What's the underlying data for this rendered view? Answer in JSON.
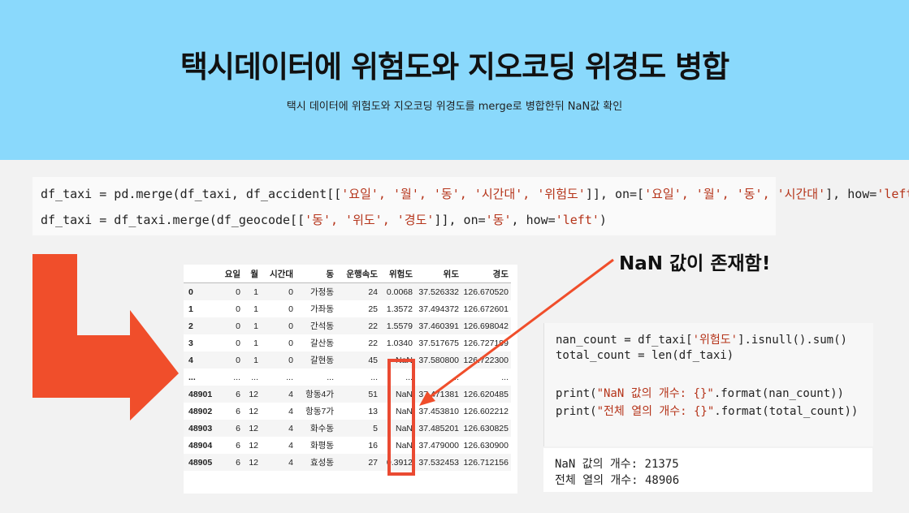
{
  "header": {
    "title": "택시데이터에 위험도와 지오코딩 위경도 병합",
    "subtitle": "택시 데이터에 위험도와 지오코딩 위경도를 merge로 병합한뒤 NaN값 확인"
  },
  "code_cell_1": {
    "line1_a": "df_taxi = pd.merge(df_taxi, df_accident[[",
    "line1_s1": "'요일', '월', '동', '시간대', '위험도'",
    "line1_b": "]], on=[",
    "line1_s2": "'요일', '월', '동', '시간대'",
    "line1_c": "], how=",
    "line1_s3": "'left'",
    "line1_d": ")",
    "line2_a": "df_taxi = df_taxi.merge(df_geocode[[",
    "line2_s1": "'동', '위도', '경도'",
    "line2_b": "]], on=",
    "line2_s2": "'동'",
    "line2_c": ", how=",
    "line2_s3": "'left'",
    "line2_d": ")"
  },
  "dataframe": {
    "columns": [
      "",
      "요일",
      "월",
      "시간대",
      "동",
      "운행속도",
      "위험도",
      "위도",
      "경도"
    ],
    "rows": [
      [
        "0",
        "0",
        "1",
        "0",
        "가정동",
        "24",
        "0.0068",
        "37.526332",
        "126.670520"
      ],
      [
        "1",
        "0",
        "1",
        "0",
        "가좌동",
        "25",
        "1.3572",
        "37.494372",
        "126.672601"
      ],
      [
        "2",
        "0",
        "1",
        "0",
        "간석동",
        "22",
        "1.5579",
        "37.460391",
        "126.698042"
      ],
      [
        "3",
        "0",
        "1",
        "0",
        "갈산동",
        "22",
        "1.0340",
        "37.517675",
        "126.727199"
      ],
      [
        "4",
        "0",
        "1",
        "0",
        "갈현동",
        "45",
        "NaN",
        "37.580800",
        "126.722300"
      ],
      [
        "...",
        "...",
        "...",
        "...",
        "...",
        "...",
        "...",
        "...",
        "..."
      ],
      [
        "48901",
        "6",
        "12",
        "4",
        "항동4가",
        "51",
        "NaN",
        "37.471381",
        "126.620485"
      ],
      [
        "48902",
        "6",
        "12",
        "4",
        "항동7가",
        "13",
        "NaN",
        "37.453810",
        "126.602212"
      ],
      [
        "48903",
        "6",
        "12",
        "4",
        "화수동",
        "5",
        "NaN",
        "37.485201",
        "126.630825"
      ],
      [
        "48904",
        "6",
        "12",
        "4",
        "화평동",
        "16",
        "NaN",
        "37.479000",
        "126.630900"
      ],
      [
        "48905",
        "6",
        "12",
        "4",
        "효성동",
        "27",
        "0.3912",
        "37.532453",
        "126.712156"
      ]
    ]
  },
  "annotation": {
    "text": "NaN 값이 존재함!"
  },
  "code_cell_2": {
    "l1_a": "nan_count = df_taxi[",
    "l1_s": "'위험도'",
    "l1_b": "].isnull().sum()",
    "l2": "total_count = len(df_taxi)",
    "l3_a": "print(",
    "l3_s": "\"NaN 값의 개수: {}\"",
    "l3_b": ".format(nan_count))",
    "l4_a": "print(",
    "l4_s": "\"전체 열의 개수: {}\"",
    "l4_b": ".format(total_count))"
  },
  "output": {
    "line1": "NaN 값의 개수: 21375",
    "line2": "전체 열의 개수: 48906"
  },
  "colors": {
    "header_bg": "#8ad9fc",
    "accent_red": "#ea4a32",
    "arrow_big": "#f04e2b"
  }
}
